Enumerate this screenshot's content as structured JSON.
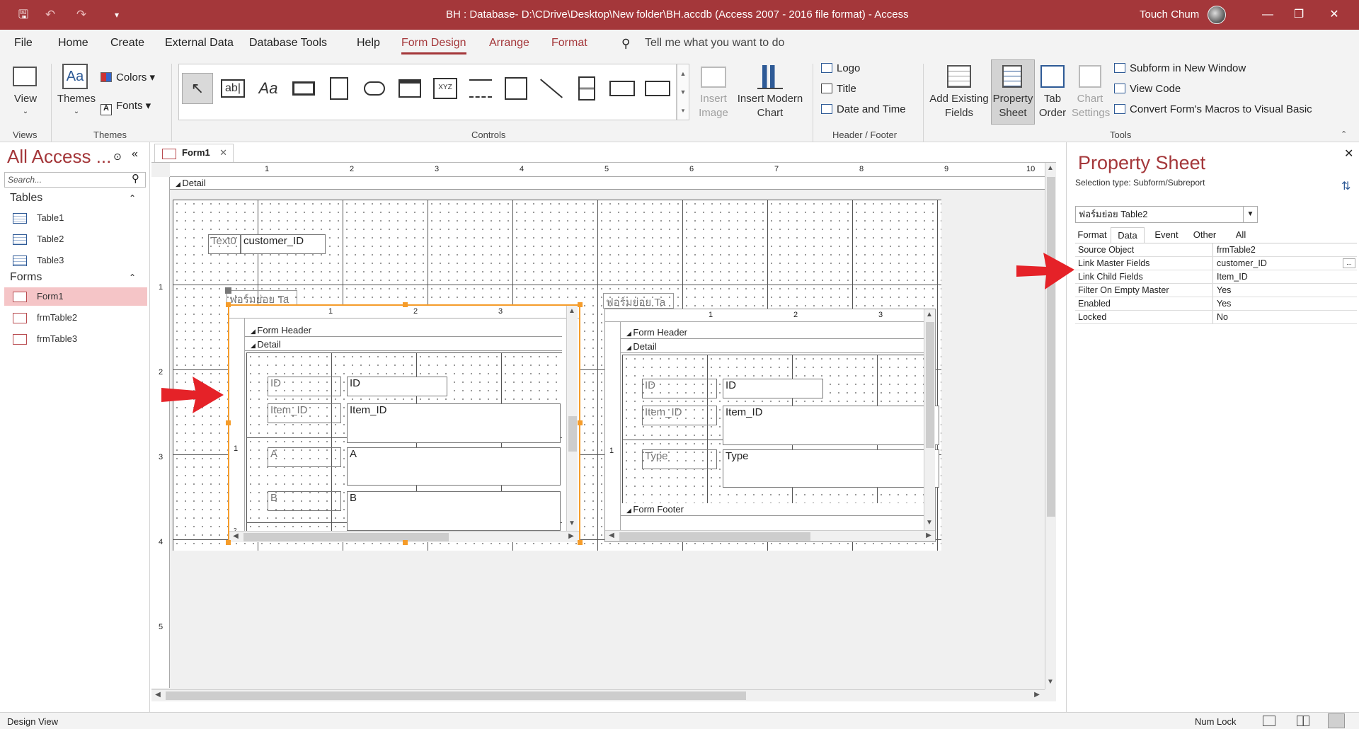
{
  "window": {
    "title": "BH : Database- D:\\CDrive\\Desktop\\New folder\\BH.accdb (Access 2007 - 2016 file format)  -  Access",
    "user": "Touch Chum"
  },
  "menu_tabs": [
    "File",
    "Home",
    "Create",
    "External Data",
    "Database Tools",
    "Help",
    "Form Design",
    "Arrange",
    "Format"
  ],
  "active_tab": "Form Design",
  "tell_me": "Tell me what you want to do",
  "ribbon": {
    "views": {
      "view_label": "View",
      "group": "Views"
    },
    "themes": {
      "themes_label": "Themes",
      "colors_label": "Colors",
      "fonts_label": "Fonts",
      "group": "Themes"
    },
    "controls": {
      "group": "Controls",
      "insert_image": "Insert Image",
      "insert_modern_chart": "Insert Modern Chart",
      "textbox_glyph": "ab|",
      "label_glyph": "Aa",
      "xyz_glyph": "XYZ"
    },
    "header_footer": {
      "logo": "Logo",
      "title": "Title",
      "date_time": "Date and Time",
      "group": "Header / Footer"
    },
    "tools": {
      "add_existing_fields": "Add Existing Fields",
      "property_sheet": "Property Sheet",
      "tab_order": "Tab Order",
      "chart_settings": "Chart Settings",
      "subform_new_window": "Subform in New Window",
      "view_code": "View Code",
      "convert_macros": "Convert Form's Macros to Visual Basic",
      "group": "Tools"
    }
  },
  "nav": {
    "title": "All Access ...",
    "search_placeholder": "Search...",
    "tables_header": "Tables",
    "tables": [
      "Table1",
      "Table2",
      "Table3"
    ],
    "forms_header": "Forms",
    "forms": [
      "Form1",
      "frmTable2",
      "frmTable3"
    ],
    "selected_form": "Form1"
  },
  "document": {
    "tab_label": "Form1",
    "ruler_h": [
      "1",
      "2",
      "3",
      "4",
      "5",
      "6",
      "7",
      "8",
      "9",
      "10"
    ],
    "ruler_v": [
      "1",
      "2",
      "3",
      "4",
      "5"
    ],
    "detail_label": "Detail",
    "text0_label": "Text0",
    "customer_field": "customer_ID",
    "subform1": {
      "caption": "ฟอร์มย่อย Ta",
      "form_header": "Form Header",
      "detail": "Detail",
      "ruler": [
        "1",
        "2",
        "3"
      ],
      "vruler": [
        "1",
        "2"
      ],
      "fields": [
        {
          "label": "ID",
          "value": "ID"
        },
        {
          "label": "Item_ID",
          "value": "Item_ID"
        },
        {
          "label": "A",
          "value": "A"
        },
        {
          "label": "B",
          "value": "B"
        }
      ]
    },
    "subform2": {
      "caption": "ฟอร์มย่อย Ta",
      "form_header": "Form Header",
      "detail": "Detail",
      "form_footer": "Form Footer",
      "ruler": [
        "1",
        "2",
        "3"
      ],
      "vruler": [
        "1"
      ],
      "fields": [
        {
          "label": "ID",
          "value": "ID"
        },
        {
          "label": "Item_ID",
          "value": "Item_ID"
        },
        {
          "label": "Type",
          "value": "Type"
        }
      ]
    }
  },
  "property_sheet": {
    "title": "Property Sheet",
    "selection_type": "Selection type:  Subform/Subreport",
    "object": "ฟอร์มย่อย Table2",
    "tabs": [
      "Format",
      "Data",
      "Event",
      "Other",
      "All"
    ],
    "active_tab": "Data",
    "rows": [
      {
        "name": "Source Object",
        "value": "frmTable2"
      },
      {
        "name": "Link Master Fields",
        "value": "customer_ID"
      },
      {
        "name": "Link Child Fields",
        "value": "Item_ID"
      },
      {
        "name": "Filter On Empty Master",
        "value": "Yes"
      },
      {
        "name": "Enabled",
        "value": "Yes"
      },
      {
        "name": "Locked",
        "value": "No"
      }
    ],
    "builder_glyph": "..."
  },
  "status": {
    "left": "Design View",
    "num_lock": "Num Lock"
  },
  "colors": {
    "accent": "#a4373a",
    "arrow": "#e52228",
    "selection": "#f59c2a"
  }
}
